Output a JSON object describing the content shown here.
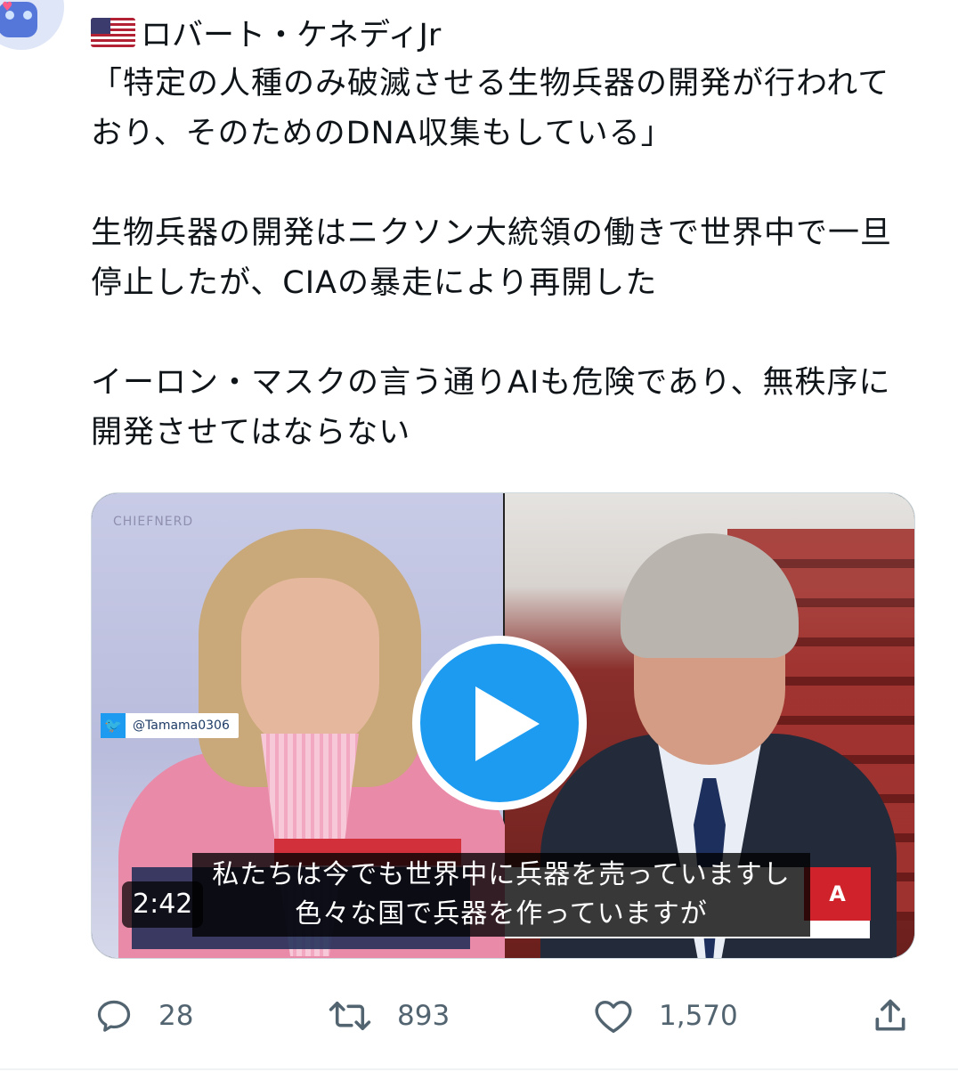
{
  "author": {
    "name": "ロバート・ケネディJr",
    "flag_icon": "us-flag-icon"
  },
  "tweet": {
    "paragraphs": [
      "「特定の人種のみ破滅させる生物兵器の開発が行われており、そのためのDNA収集もしている」",
      "生物兵器の開発はニクソン大統領の働きで世界中で一旦停止したが、CIAの暴走により再開した",
      "イーロン・マスクの言う通りAIも危険であり、無秩序に開発させてはならない"
    ]
  },
  "video": {
    "watermark": "CHIEFNERD",
    "handle": "@Tamama0306",
    "subtitle_line1": "私たちは今でも世界中に兵器を売っていますし",
    "subtitle_line2": "色々な国で兵器を作っていますが",
    "duration": "2:42",
    "accent_color": "#1d9bf0"
  },
  "actions": {
    "replies": "28",
    "retweets": "893",
    "likes": "1,570"
  }
}
